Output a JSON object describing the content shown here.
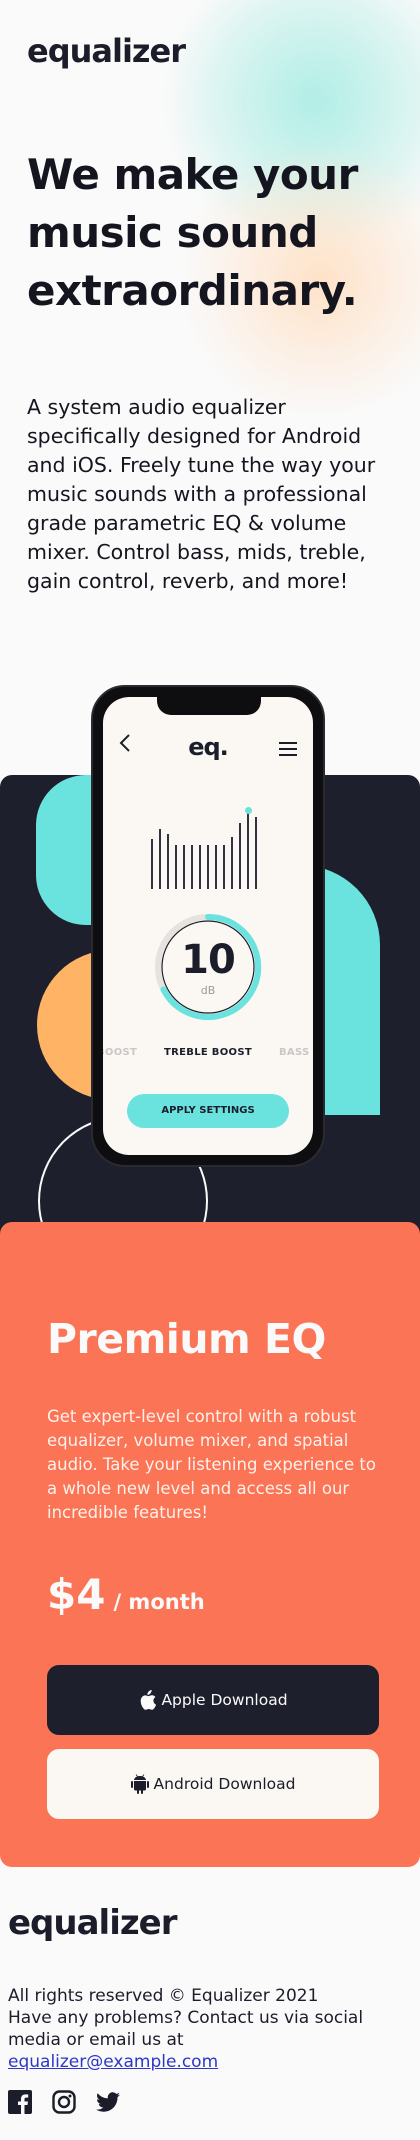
{
  "header": {
    "logo": "equalizer"
  },
  "hero": {
    "headline": "We make your music sound extraordinary.",
    "intro": "A system audio equalizer specifically designed for Android and iOS. Freely tune the way your music sounds with a professional grade parametric EQ & volume mixer. Control bass, mids, treble, gain control, reverb, and more!"
  },
  "phone": {
    "logo": "eq.",
    "back_icon": "chevron-left-icon",
    "menu_icon": "hamburger-menu-icon",
    "dial_value": "10",
    "dial_unit": "dB",
    "modes": [
      "BOOST",
      "TREBLE BOOST",
      "BASS B"
    ],
    "apply_label": "APPLY SETTINGS"
  },
  "premium": {
    "title": "Premium EQ",
    "description": "Get expert-level control with a robust equalizer, volume mixer, and spatial audio. Take your listening experience to a whole new level and access all our incredible features!",
    "price": "$4",
    "period": "/ month",
    "apple_button": "Apple Download",
    "android_button": "Android Download"
  },
  "footer": {
    "logo": "equalizer",
    "copyright": "All rights reserved © Equalizer 2021",
    "contact": "Have any problems? Contact us via social media or email us at",
    "email": "equalizer@example.com",
    "socials": [
      "facebook-icon",
      "instagram-icon",
      "twitter-icon"
    ]
  },
  "colors": {
    "dark": "#1e1f2c",
    "teal": "#6ae3de",
    "orange": "#ffb364",
    "coral": "#fa7455",
    "cream": "#fbf7f3"
  }
}
